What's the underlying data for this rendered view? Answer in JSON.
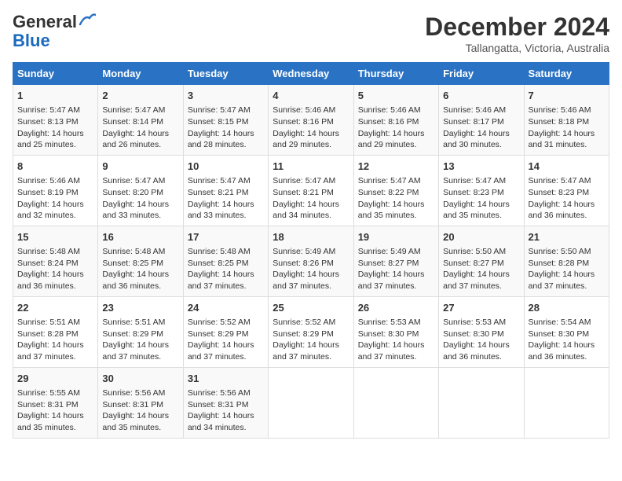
{
  "header": {
    "logo_general": "General",
    "logo_blue": "Blue",
    "month": "December 2024",
    "location": "Tallangatta, Victoria, Australia"
  },
  "days_of_week": [
    "Sunday",
    "Monday",
    "Tuesday",
    "Wednesday",
    "Thursday",
    "Friday",
    "Saturday"
  ],
  "weeks": [
    [
      {
        "day": "1",
        "sunrise": "Sunrise: 5:47 AM",
        "sunset": "Sunset: 8:13 PM",
        "daylight": "Daylight: 14 hours and 25 minutes."
      },
      {
        "day": "2",
        "sunrise": "Sunrise: 5:47 AM",
        "sunset": "Sunset: 8:14 PM",
        "daylight": "Daylight: 14 hours and 26 minutes."
      },
      {
        "day": "3",
        "sunrise": "Sunrise: 5:47 AM",
        "sunset": "Sunset: 8:15 PM",
        "daylight": "Daylight: 14 hours and 28 minutes."
      },
      {
        "day": "4",
        "sunrise": "Sunrise: 5:46 AM",
        "sunset": "Sunset: 8:16 PM",
        "daylight": "Daylight: 14 hours and 29 minutes."
      },
      {
        "day": "5",
        "sunrise": "Sunrise: 5:46 AM",
        "sunset": "Sunset: 8:16 PM",
        "daylight": "Daylight: 14 hours and 29 minutes."
      },
      {
        "day": "6",
        "sunrise": "Sunrise: 5:46 AM",
        "sunset": "Sunset: 8:17 PM",
        "daylight": "Daylight: 14 hours and 30 minutes."
      },
      {
        "day": "7",
        "sunrise": "Sunrise: 5:46 AM",
        "sunset": "Sunset: 8:18 PM",
        "daylight": "Daylight: 14 hours and 31 minutes."
      }
    ],
    [
      {
        "day": "8",
        "sunrise": "Sunrise: 5:46 AM",
        "sunset": "Sunset: 8:19 PM",
        "daylight": "Daylight: 14 hours and 32 minutes."
      },
      {
        "day": "9",
        "sunrise": "Sunrise: 5:47 AM",
        "sunset": "Sunset: 8:20 PM",
        "daylight": "Daylight: 14 hours and 33 minutes."
      },
      {
        "day": "10",
        "sunrise": "Sunrise: 5:47 AM",
        "sunset": "Sunset: 8:21 PM",
        "daylight": "Daylight: 14 hours and 33 minutes."
      },
      {
        "day": "11",
        "sunrise": "Sunrise: 5:47 AM",
        "sunset": "Sunset: 8:21 PM",
        "daylight": "Daylight: 14 hours and 34 minutes."
      },
      {
        "day": "12",
        "sunrise": "Sunrise: 5:47 AM",
        "sunset": "Sunset: 8:22 PM",
        "daylight": "Daylight: 14 hours and 35 minutes."
      },
      {
        "day": "13",
        "sunrise": "Sunrise: 5:47 AM",
        "sunset": "Sunset: 8:23 PM",
        "daylight": "Daylight: 14 hours and 35 minutes."
      },
      {
        "day": "14",
        "sunrise": "Sunrise: 5:47 AM",
        "sunset": "Sunset: 8:23 PM",
        "daylight": "Daylight: 14 hours and 36 minutes."
      }
    ],
    [
      {
        "day": "15",
        "sunrise": "Sunrise: 5:48 AM",
        "sunset": "Sunset: 8:24 PM",
        "daylight": "Daylight: 14 hours and 36 minutes."
      },
      {
        "day": "16",
        "sunrise": "Sunrise: 5:48 AM",
        "sunset": "Sunset: 8:25 PM",
        "daylight": "Daylight: 14 hours and 36 minutes."
      },
      {
        "day": "17",
        "sunrise": "Sunrise: 5:48 AM",
        "sunset": "Sunset: 8:25 PM",
        "daylight": "Daylight: 14 hours and 37 minutes."
      },
      {
        "day": "18",
        "sunrise": "Sunrise: 5:49 AM",
        "sunset": "Sunset: 8:26 PM",
        "daylight": "Daylight: 14 hours and 37 minutes."
      },
      {
        "day": "19",
        "sunrise": "Sunrise: 5:49 AM",
        "sunset": "Sunset: 8:27 PM",
        "daylight": "Daylight: 14 hours and 37 minutes."
      },
      {
        "day": "20",
        "sunrise": "Sunrise: 5:50 AM",
        "sunset": "Sunset: 8:27 PM",
        "daylight": "Daylight: 14 hours and 37 minutes."
      },
      {
        "day": "21",
        "sunrise": "Sunrise: 5:50 AM",
        "sunset": "Sunset: 8:28 PM",
        "daylight": "Daylight: 14 hours and 37 minutes."
      }
    ],
    [
      {
        "day": "22",
        "sunrise": "Sunrise: 5:51 AM",
        "sunset": "Sunset: 8:28 PM",
        "daylight": "Daylight: 14 hours and 37 minutes."
      },
      {
        "day": "23",
        "sunrise": "Sunrise: 5:51 AM",
        "sunset": "Sunset: 8:29 PM",
        "daylight": "Daylight: 14 hours and 37 minutes."
      },
      {
        "day": "24",
        "sunrise": "Sunrise: 5:52 AM",
        "sunset": "Sunset: 8:29 PM",
        "daylight": "Daylight: 14 hours and 37 minutes."
      },
      {
        "day": "25",
        "sunrise": "Sunrise: 5:52 AM",
        "sunset": "Sunset: 8:29 PM",
        "daylight": "Daylight: 14 hours and 37 minutes."
      },
      {
        "day": "26",
        "sunrise": "Sunrise: 5:53 AM",
        "sunset": "Sunset: 8:30 PM",
        "daylight": "Daylight: 14 hours and 37 minutes."
      },
      {
        "day": "27",
        "sunrise": "Sunrise: 5:53 AM",
        "sunset": "Sunset: 8:30 PM",
        "daylight": "Daylight: 14 hours and 36 minutes."
      },
      {
        "day": "28",
        "sunrise": "Sunrise: 5:54 AM",
        "sunset": "Sunset: 8:30 PM",
        "daylight": "Daylight: 14 hours and 36 minutes."
      }
    ],
    [
      {
        "day": "29",
        "sunrise": "Sunrise: 5:55 AM",
        "sunset": "Sunset: 8:31 PM",
        "daylight": "Daylight: 14 hours and 35 minutes."
      },
      {
        "day": "30",
        "sunrise": "Sunrise: 5:56 AM",
        "sunset": "Sunset: 8:31 PM",
        "daylight": "Daylight: 14 hours and 35 minutes."
      },
      {
        "day": "31",
        "sunrise": "Sunrise: 5:56 AM",
        "sunset": "Sunset: 8:31 PM",
        "daylight": "Daylight: 14 hours and 34 minutes."
      },
      null,
      null,
      null,
      null
    ]
  ]
}
